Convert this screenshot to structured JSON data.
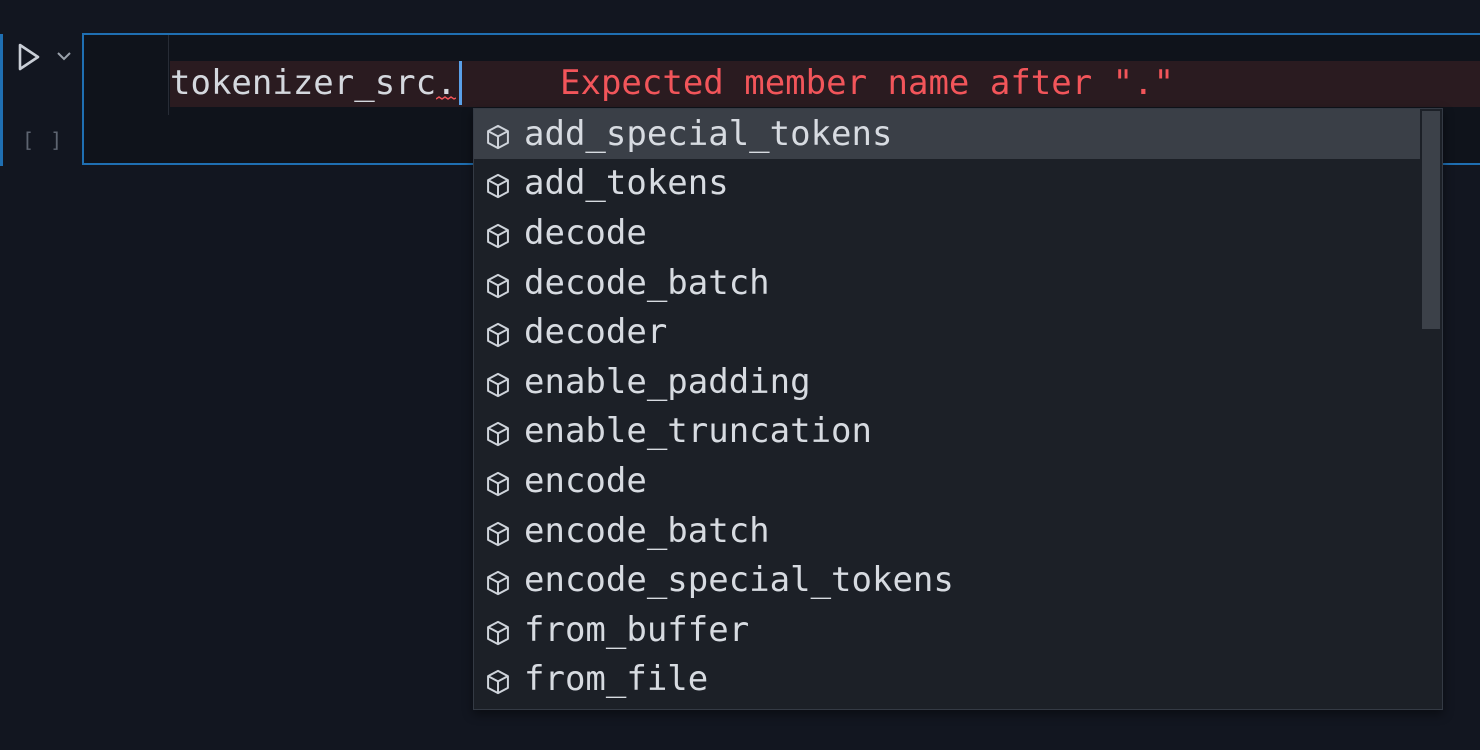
{
  "editor": {
    "code": "tokenizer_src",
    "dot": ".",
    "error_message": "Expected member name after \".\"",
    "execution_count": "[ ]"
  },
  "suggestions": {
    "selected_index": 0,
    "icon": "cube-icon",
    "items": [
      {
        "label": "add_special_tokens"
      },
      {
        "label": "add_tokens"
      },
      {
        "label": "decode"
      },
      {
        "label": "decode_batch"
      },
      {
        "label": "decoder"
      },
      {
        "label": "enable_padding"
      },
      {
        "label": "enable_truncation"
      },
      {
        "label": "encode"
      },
      {
        "label": "encode_batch"
      },
      {
        "label": "encode_special_tokens"
      },
      {
        "label": "from_buffer"
      },
      {
        "label": "from_file"
      }
    ]
  },
  "colors": {
    "accent": "#1f6fb2",
    "error": "#f2555a",
    "background": "#121620",
    "widget_background": "#1c2027",
    "selected_row": "#3a3f47"
  }
}
